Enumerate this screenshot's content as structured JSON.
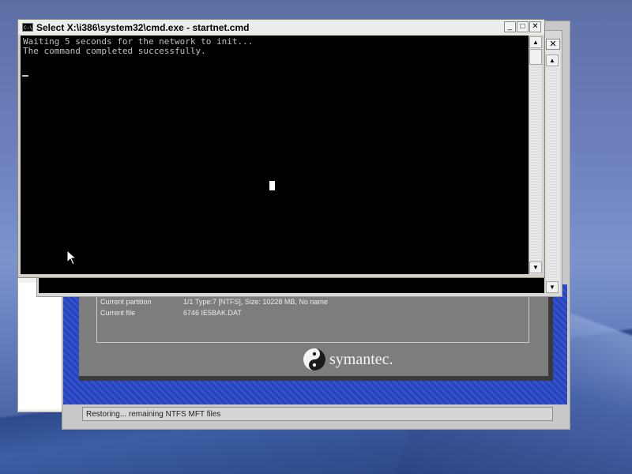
{
  "cmd_window": {
    "title": "Select X:\\i386\\system32\\cmd.exe - startnet.cmd",
    "icon": "console-icon",
    "icon_text": "C:\\",
    "lines": [
      "Waiting 5 seconds for the network to init...",
      "The command completed successfully."
    ],
    "buttons": {
      "minimize": "_",
      "maximize": "□",
      "close": "✕"
    },
    "scroll_up": "▲",
    "scroll_down": "▼"
  },
  "background_cmd_window": {
    "close": "✕",
    "scroll_up": "▲",
    "scroll_down": "▼"
  },
  "ghost_window": {
    "rows": [
      {
        "label": "Current partition",
        "value": "1/1 Type:7 [NTFS], Size: 10228 MB, No name"
      },
      {
        "label": "Current file",
        "value": "6746 IE5BAK.DAT"
      }
    ],
    "logo_text": "symantec.",
    "status": "Restoring... remaining NTFS MFT files"
  },
  "colors": {
    "console_bg": "#000000",
    "console_text": "#c0c0c0",
    "panel_gray": "#7d7d7d",
    "ghost_blue": "#2f4dc4"
  }
}
